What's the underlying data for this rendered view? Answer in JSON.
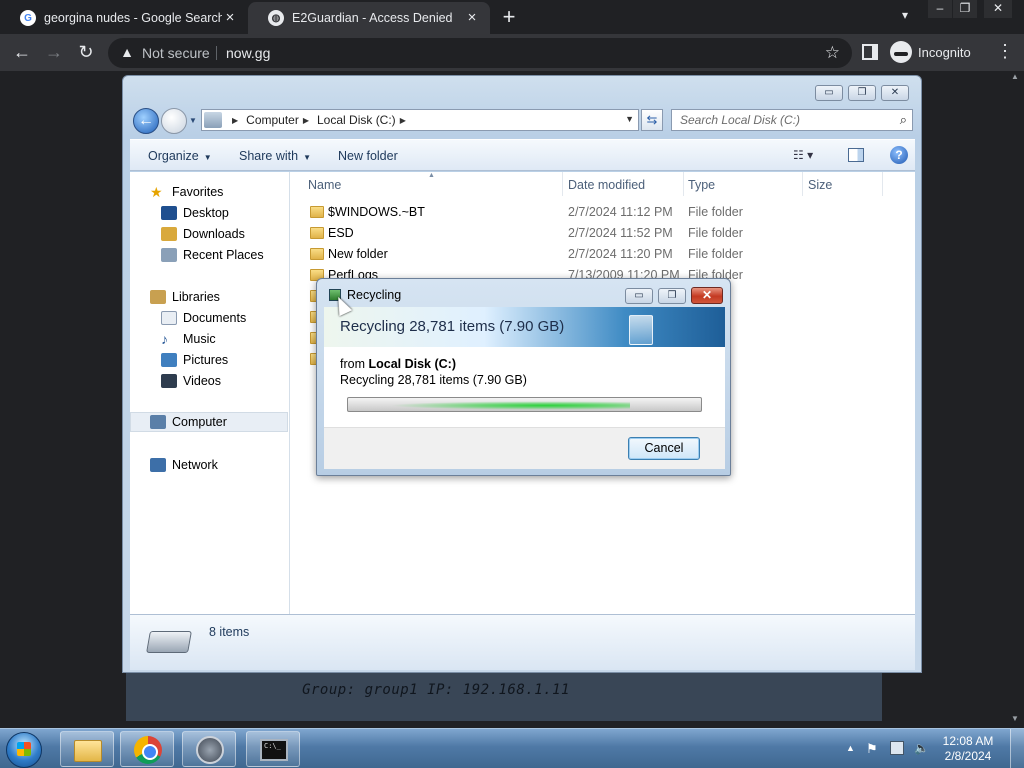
{
  "browser": {
    "tabs": [
      {
        "title": "georgina nudes - Google Search",
        "favicon": "google-icon",
        "active": false
      },
      {
        "title": "E2Guardian - Access Denied",
        "favicon": "globe-icon",
        "active": true
      }
    ],
    "security_label": "Not secure",
    "url": "now.gg",
    "incognito_label": "Incognito"
  },
  "explorer": {
    "breadcrumb": [
      "Computer",
      "Local Disk (C:)"
    ],
    "search_placeholder": "Search Local Disk (C:)",
    "commands": {
      "organize": "Organize",
      "share_with": "Share with",
      "new_folder": "New folder"
    },
    "nav": {
      "favorites": "Favorites",
      "desktop": "Desktop",
      "downloads": "Downloads",
      "recent_places": "Recent Places",
      "libraries": "Libraries",
      "documents": "Documents",
      "music": "Music",
      "pictures": "Pictures",
      "videos": "Videos",
      "computer": "Computer",
      "network": "Network"
    },
    "columns": {
      "name": "Name",
      "date_modified": "Date modified",
      "type": "Type",
      "size": "Size"
    },
    "files": [
      {
        "name": "$WINDOWS.~BT",
        "date": "2/7/2024 11:12 PM",
        "type": "File folder"
      },
      {
        "name": "ESD",
        "date": "2/7/2024 11:52 PM",
        "type": "File folder"
      },
      {
        "name": "New folder",
        "date": "2/7/2024 11:20 PM",
        "type": "File folder"
      },
      {
        "name": "PerfLogs",
        "date": "7/13/2009 11:20 PM",
        "type": "File folder"
      }
    ],
    "item_count": "8 items"
  },
  "dialog": {
    "title": "Recycling",
    "headline": "Recycling 28,781 items (7.90 GB)",
    "from_label": "from",
    "from_location": "Local Disk (C:)",
    "subline": "Recycling 28,781 items (7.90 GB)",
    "progress_fraction": 0.8,
    "cancel_label": "Cancel"
  },
  "desktop": {
    "group_info": "Group: group1   IP: 192.168.1.11"
  },
  "taskbar": {
    "time": "12:08 AM",
    "date": "2/8/2024"
  }
}
